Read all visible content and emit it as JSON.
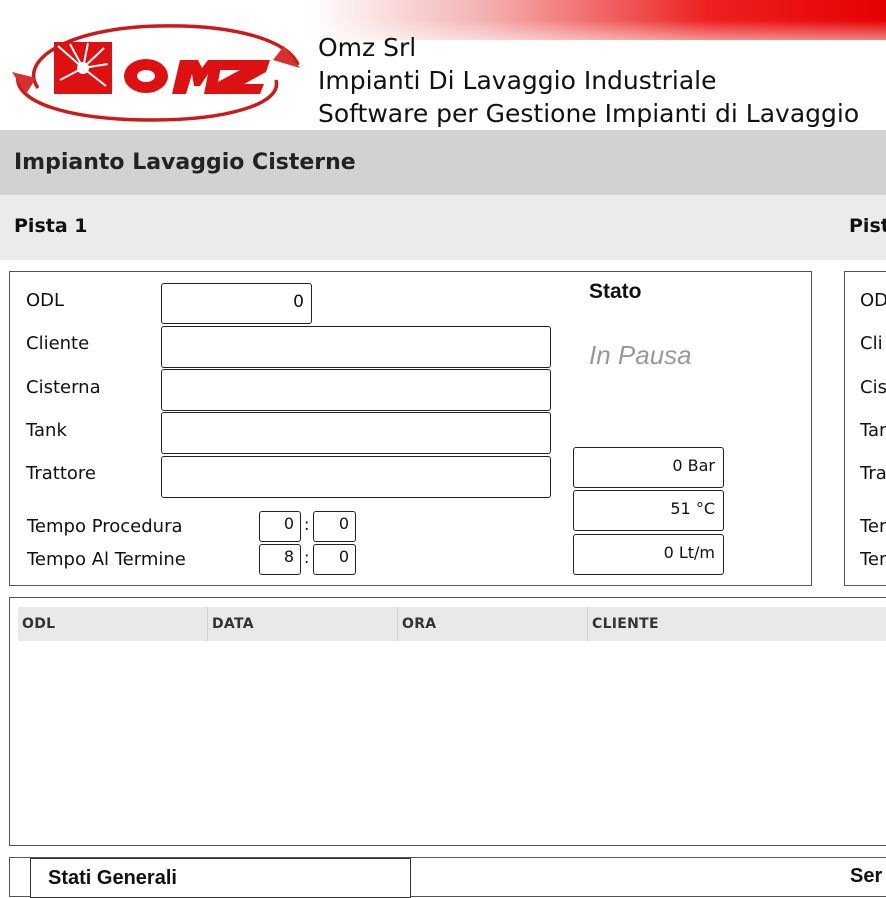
{
  "company": {
    "name": "Omz Srl",
    "tagline": "Impianti Di Lavaggio Industriale",
    "product": "Software per Gestione Impianti di Lavaggio",
    "logo_text": "omz"
  },
  "page_title": "Impianto Lavaggio Cisterne",
  "pista1": {
    "title": "Pista 1",
    "fields": {
      "odl_label": "ODL",
      "odl_value": "0",
      "cliente_label": "Cliente",
      "cliente_value": "",
      "cisterna_label": "Cisterna",
      "cisterna_value": "",
      "tank_label": "Tank",
      "tank_value": "",
      "trattore_label": "Trattore",
      "trattore_value": ""
    },
    "tempo_procedura_label": "Tempo Procedura",
    "tempo_procedura_min": "0",
    "tempo_procedura_sec": "0",
    "tempo_termine_label": "Tempo Al Termine",
    "tempo_termine_min": "8",
    "tempo_termine_sec": "0",
    "stato_label": "Stato",
    "stato_value": "In Pausa",
    "pressure": "0 Bar",
    "temperature": "51 °C",
    "flow": "0 Lt/m"
  },
  "pista2": {
    "title": "Pist",
    "labels": [
      "OD",
      "Cli",
      "Cis",
      "Tar",
      "Tra",
      "Ter",
      "Ter"
    ]
  },
  "table": {
    "columns": [
      "ODL",
      "DATA",
      "ORA",
      "CLIENTE"
    ],
    "rows": []
  },
  "bottom": {
    "stati_generali": "Stati Generali",
    "right_label": "Ser"
  },
  "colors": {
    "brand_red": "#e50000",
    "title_band": "#d2d2d2",
    "pista_band": "#ebebeb",
    "stato_text": "#999999"
  }
}
